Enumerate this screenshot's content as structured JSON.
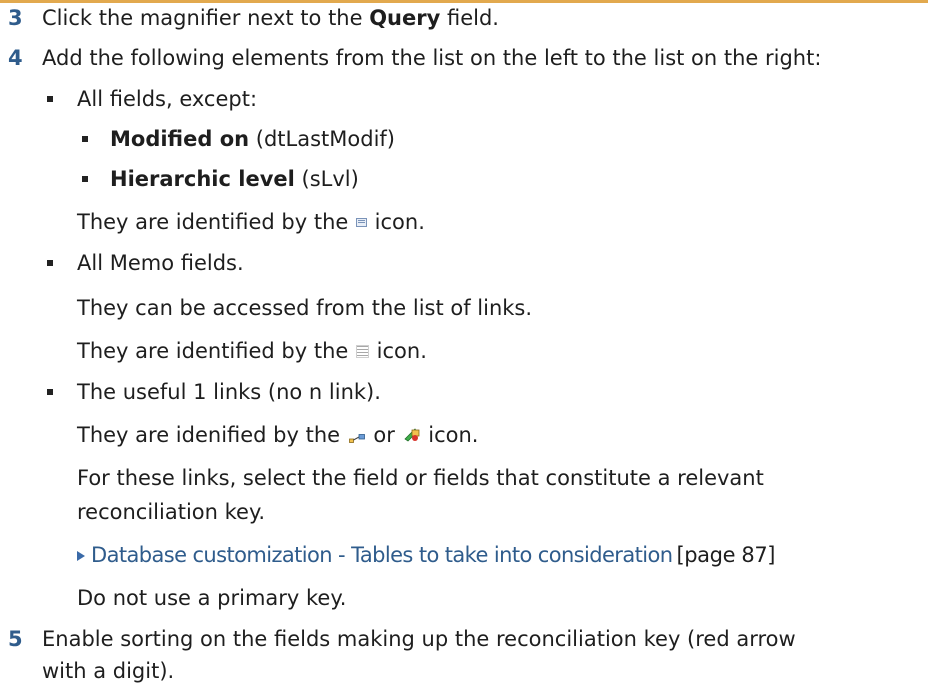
{
  "steps": [
    {
      "number": "3",
      "pre": "Click the magnifier next to the ",
      "bold": "Query",
      "post": " field."
    },
    {
      "number": "4",
      "text": "Add the following elements from the list on the left to the list on the right:"
    },
    {
      "number": "5",
      "text_line1": "Enable sorting on the fields making up the reconciliation key (red arrow",
      "text_line2": "with a digit)."
    }
  ],
  "bullets": {
    "all_fields": "All fields, except:",
    "except_1": {
      "bold": "Modified on",
      "rest": " (dtLastModif)"
    },
    "except_2": {
      "bold": "Hierarchic level",
      "rest": " (sLvl)"
    },
    "fields_icon_note": {
      "pre": "They are identified by the ",
      "post": " icon."
    },
    "memo": "All Memo fields.",
    "memo_access": "They can be accessed from the list of links.",
    "memo_icon_note": {
      "pre": "They are identified by the ",
      "post": " icon."
    },
    "links": "The useful 1 links (no n link).",
    "links_icon_note": {
      "pre": "They are idenified by the ",
      "mid": " or ",
      "post": " icon."
    },
    "links_select_1": "For these links, select the field or fields that constitute a relevant",
    "links_select_2": "reconciliation key.",
    "xref_text": "Database customization - Tables to take into consideration",
    "xref_page": "[page 87]",
    "no_primary": "Do not use a primary key."
  },
  "icons": {
    "field": "field-icon",
    "memo": "memo-icon",
    "link": "link-icon",
    "link_alt": "link-alt-icon",
    "xref": "triangle-right-icon"
  },
  "colors": {
    "step_number": "#2f5c8c",
    "xref": "#2f5c8c",
    "top_rule": "#e2a94e"
  }
}
